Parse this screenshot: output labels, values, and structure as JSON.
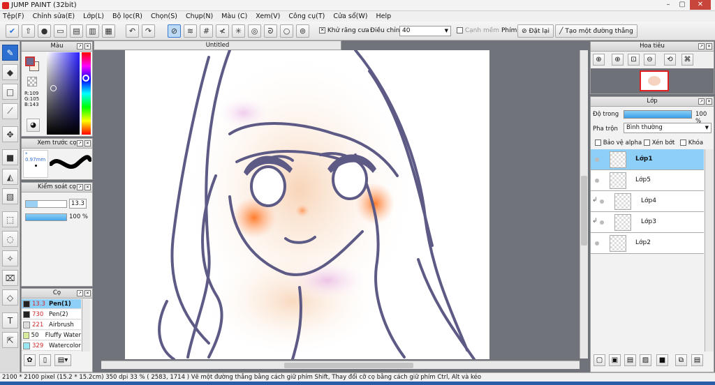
{
  "window": {
    "title": "JUMP PAINT (32bit)"
  },
  "menu": [
    "Tệp(F)",
    "Chỉnh sửa(E)",
    "Lớp(L)",
    "Bộ lọc(R)",
    "Chọn(S)",
    "Chụp(N)",
    "Màu (C)",
    "Xem(V)",
    "Công cụ(T)",
    "Cửa sổ(W)",
    "Help"
  ],
  "toolbar": {
    "antialias_label": "Khử răng cưa",
    "adjust_label": "Điều chỉnh",
    "adjust_value": "40",
    "edge_label": "Cạnh mềm",
    "key_label": "Phím",
    "reset_label": "Đặt lại",
    "line_label": "Tạo một đường thẳng"
  },
  "color_panel": {
    "title": "Màu",
    "r": "R:109",
    "g": "G:105",
    "b": "B:143",
    "primary": "#6d698f",
    "secondary": "#fbeee0"
  },
  "preview_panel": {
    "title": "Xem trước cọ",
    "size": "0.97mm"
  },
  "brush_control": {
    "title": "Kiểm soát cọ",
    "size_value": "13.3",
    "opacity_value": "100 %"
  },
  "brush_panel": {
    "title": "Cọ",
    "items": [
      {
        "size": "13.3",
        "name": "Pen(1)",
        "color": "#222222"
      },
      {
        "size": "730",
        "name": "Pen(2)",
        "color": "#222222"
      },
      {
        "size": "221",
        "name": "Airbrush",
        "color": "#dddddd"
      },
      {
        "size": "50",
        "name": "Fluffy Water",
        "color": "#d6ec9a"
      },
      {
        "size": "329",
        "name": "Watercolor",
        "color": "#9ae6f2"
      }
    ]
  },
  "document": {
    "tab": "Untitled"
  },
  "navigator": {
    "title": "Hoa tiêu"
  },
  "layer_panel": {
    "title": "Lớp",
    "opacity_label": "Độ trong",
    "opacity_value": "100 %",
    "blend_label": "Pha trộn",
    "blend_value": "Bình thường",
    "protect_alpha": "Bảo vệ alpha",
    "clip": "Xén bớt",
    "lock": "Khóa",
    "layers": [
      {
        "name": "Lớp1"
      },
      {
        "name": "Lớp5"
      },
      {
        "name": "Lớp4"
      },
      {
        "name": "Lớp3"
      },
      {
        "name": "Lớp2"
      }
    ]
  },
  "status": {
    "text": "2100 * 2100 pixel   (15.2 * 15.2cm)   350 dpi   33 %   ( 2583, 1714 )   Vẽ một đường thẳng bằng cách giữ phím Shift, Thay đổi cỡ cọ bằng cách giữ phím Ctrl, Alt và kéo"
  }
}
